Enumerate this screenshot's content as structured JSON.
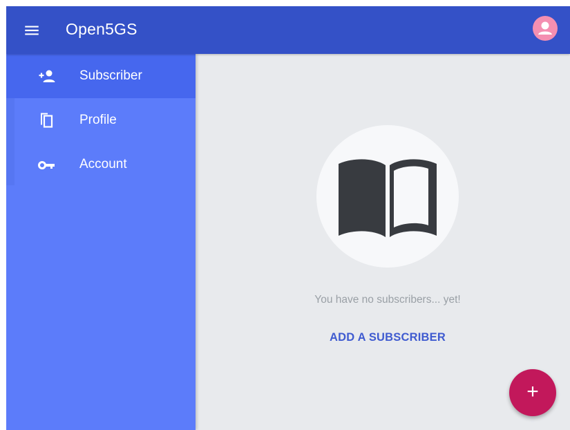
{
  "header": {
    "title": "Open5GS",
    "menu_icon": "menu-icon",
    "avatar_icon": "account-circle-icon",
    "color": "#3451c7"
  },
  "sidebar": {
    "color": "#5c7cfa",
    "items": [
      {
        "label": "Subscriber",
        "icon": "person-add-icon",
        "active": true
      },
      {
        "label": "Profile",
        "icon": "copy-icon",
        "active": false
      },
      {
        "label": "Account",
        "icon": "key-icon",
        "active": false
      }
    ]
  },
  "main": {
    "empty_icon": "book-icon",
    "empty_message": "You have no subscribers... yet!",
    "add_link": "ADD A SUBSCRIBER",
    "fab_icon": "plus-icon",
    "fab_symbol": "+",
    "fab_color": "#c2185b"
  }
}
